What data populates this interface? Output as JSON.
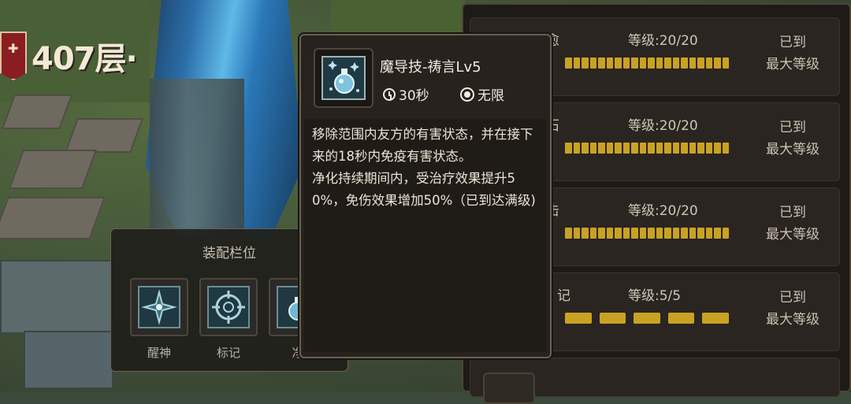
{
  "hud": {
    "floor_label": "407层·"
  },
  "equip_panel": {
    "title": "装配栏位",
    "slots": [
      {
        "label": "醒神",
        "icon": "spark-cross-icon"
      },
      {
        "label": "标记",
        "icon": "crosshair-icon"
      },
      {
        "label": "净",
        "icon": "potion-icon"
      }
    ]
  },
  "skill_list": {
    "rows": [
      {
        "name": "愈",
        "level": "等级:20/20",
        "max_line1": "已到",
        "max_line2": "最大等级",
        "segments": 20
      },
      {
        "name": "石",
        "level": "等级:20/20",
        "max_line1": "已到",
        "max_line2": "最大等级",
        "segments": 20
      },
      {
        "name": "击",
        "level": "等级:20/20",
        "max_line1": "已到",
        "max_line2": "最大等级",
        "segments": 20
      },
      {
        "name": "记",
        "level": "等级:5/5",
        "max_line1": "已到",
        "max_line2": "最大等级",
        "segments": 5
      }
    ],
    "bar_color": "#c9a224"
  },
  "tooltip": {
    "title": "魔导技-祷言Lv5",
    "duration": "30秒",
    "range": "无限",
    "icon": "potion-icon",
    "description": "移除范围内友方的有害状态，并在接下来的18秒内免疫有害状态。\n净化持续期间内，受治疗效果提升50%，免伤效果增加50%（已到达满级)"
  }
}
